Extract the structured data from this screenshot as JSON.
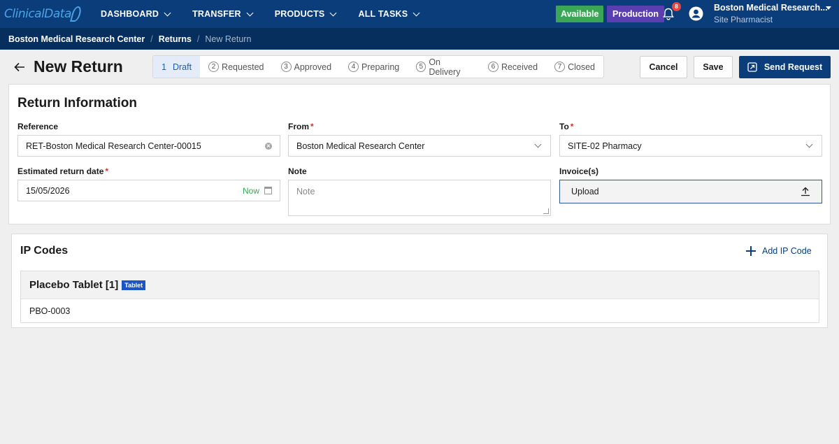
{
  "nav": {
    "logo_text": "ClinicalData",
    "items": [
      {
        "label": "DASHBOARD"
      },
      {
        "label": "TRANSFER"
      },
      {
        "label": "PRODUCTS"
      },
      {
        "label": "ALL TASKS"
      }
    ],
    "status_available": "Available",
    "environment": "Production",
    "notification_count": "8",
    "user_name": "Boston Medical Research...",
    "user_role": "Site Pharmacist"
  },
  "breadcrumb": {
    "items": [
      "Boston Medical Research Center",
      "Returns"
    ],
    "current": "New Return",
    "separator": "/"
  },
  "page": {
    "title": "New Return"
  },
  "stepper": {
    "steps": [
      {
        "num": "1",
        "label": "Draft"
      },
      {
        "num": "2",
        "label": "Requested"
      },
      {
        "num": "3",
        "label": "Approved"
      },
      {
        "num": "4",
        "label": "Preparing"
      },
      {
        "num": "5",
        "label": "On Delivery"
      },
      {
        "num": "6",
        "label": "Received"
      },
      {
        "num": "7",
        "label": "Closed"
      }
    ]
  },
  "actions": {
    "cancel": "Cancel",
    "save": "Save",
    "send": "Send Request"
  },
  "return_info": {
    "title": "Return Information",
    "reference_label": "Reference",
    "reference_value": "RET-Boston Medical Research Center-00015",
    "from_label": "From",
    "from_value": "Boston Medical Research Center",
    "to_label": "To",
    "to_value": "SITE-02 Pharmacy",
    "date_label": "Estimated return date",
    "date_value": "15/05/2026",
    "now_label": "Now",
    "note_label": "Note",
    "note_placeholder": "Note",
    "invoice_label": "Invoice(s)",
    "upload_label": "Upload",
    "required_mark": "*"
  },
  "ip_codes": {
    "title": "IP Codes",
    "add_label": "Add IP Code",
    "groups": [
      {
        "name": "Placebo Tablet [1]",
        "tag": "Tablet",
        "codes": [
          "PBO-0003"
        ]
      }
    ]
  },
  "colors": {
    "nav_bg": "#0b3d7a",
    "breadcrumb_bg": "#062f5e",
    "available": "#3aa656",
    "production": "#5b3fb0",
    "primary_button": "#0b3d7a",
    "step_active": "#1a5fb4",
    "tag": "#1a56c4"
  }
}
